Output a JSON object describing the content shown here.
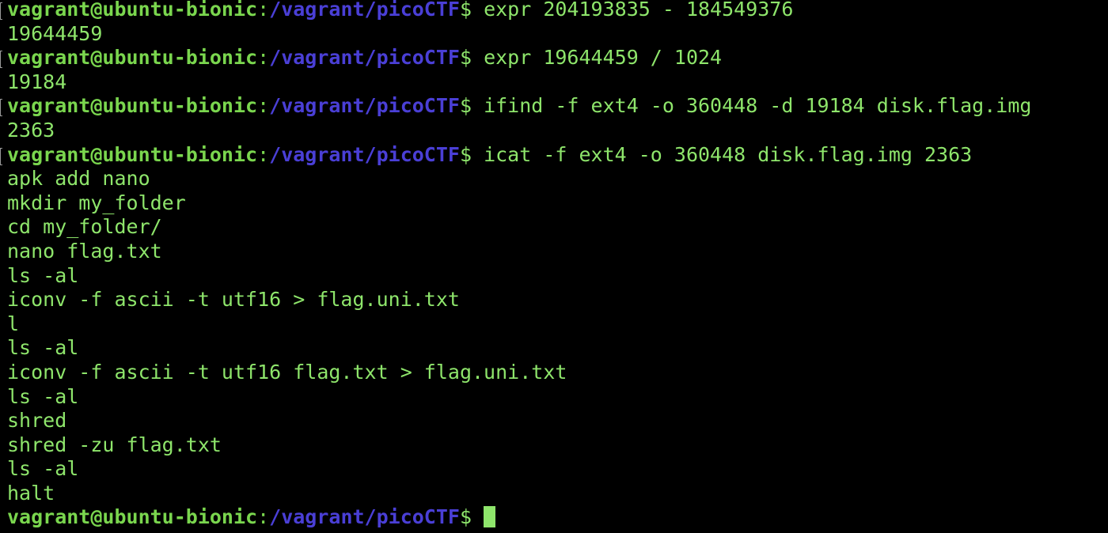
{
  "prompt": {
    "user_host": "vagrant@ubuntu-bionic",
    "separator": ":",
    "path": "/vagrant/picoCTF",
    "dollar": "$ "
  },
  "lines": [
    {
      "type": "cmd",
      "text": "expr 204193835 - 184549376"
    },
    {
      "type": "out",
      "text": "19644459"
    },
    {
      "type": "cmd",
      "text": "expr 19644459 / 1024"
    },
    {
      "type": "out",
      "text": "19184"
    },
    {
      "type": "cmd",
      "text": "ifind -f ext4 -o 360448 -d 19184 disk.flag.img"
    },
    {
      "type": "out",
      "text": "2363"
    },
    {
      "type": "cmd",
      "text": "icat -f ext4 -o 360448 disk.flag.img 2363"
    },
    {
      "type": "out",
      "text": "apk add nano"
    },
    {
      "type": "out",
      "text": "mkdir my_folder"
    },
    {
      "type": "out",
      "text": "cd my_folder/"
    },
    {
      "type": "out",
      "text": "nano flag.txt"
    },
    {
      "type": "out",
      "text": "ls -al"
    },
    {
      "type": "out",
      "text": "iconv -f ascii -t utf16 > flag.uni.txt"
    },
    {
      "type": "out",
      "text": "l"
    },
    {
      "type": "out",
      "text": "ls -al"
    },
    {
      "type": "out",
      "text": "iconv -f ascii -t utf16 flag.txt > flag.uni.txt"
    },
    {
      "type": "out",
      "text": "ls -al"
    },
    {
      "type": "out",
      "text": "shred"
    },
    {
      "type": "out",
      "text": "shred -zu flag.txt"
    },
    {
      "type": "out",
      "text": "ls -al"
    },
    {
      "type": "out",
      "text": "halt"
    },
    {
      "type": "prompt",
      "text": ""
    }
  ],
  "colors": {
    "background": "#000000",
    "text": "#8ee56b",
    "user_host": "#7ad64e",
    "path": "#4a3fd6",
    "cursor": "#8ee56b"
  }
}
